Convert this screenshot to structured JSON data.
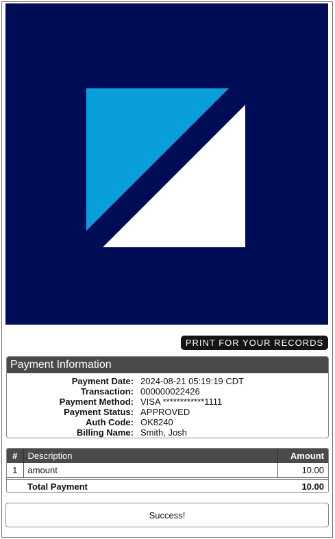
{
  "colors": {
    "logo_background": "#000c55",
    "logo_light_blue": "#0a9fdc",
    "logo_white": "#ffffff",
    "header_gray": "#4a4a4a",
    "button_black": "#141414"
  },
  "logo": {
    "icon": "company-logo-icon"
  },
  "print_button": {
    "label": "PRINT FOR YOUR RECORDS"
  },
  "payment_info": {
    "title": "Payment Information",
    "rows": [
      {
        "label": "Payment Date:",
        "value": "2024-08-21 05:19:19 CDT"
      },
      {
        "label": "Transaction:",
        "value": "000000022426"
      },
      {
        "label": "Payment Method:",
        "value": "VISA ************1111"
      },
      {
        "label": "Payment Status:",
        "value": "APPROVED"
      },
      {
        "label": "Auth Code:",
        "value": "OK8240"
      },
      {
        "label": "Billing Name:",
        "value": "Smith, Josh"
      }
    ]
  },
  "items": {
    "headers": {
      "num": "#",
      "description": "Description",
      "amount": "Amount"
    },
    "rows": [
      {
        "num": "1",
        "description": "amount",
        "amount": "10.00"
      }
    ],
    "total_label": "Total Payment",
    "total_amount": "10.00"
  },
  "status": {
    "message": "Success!"
  }
}
